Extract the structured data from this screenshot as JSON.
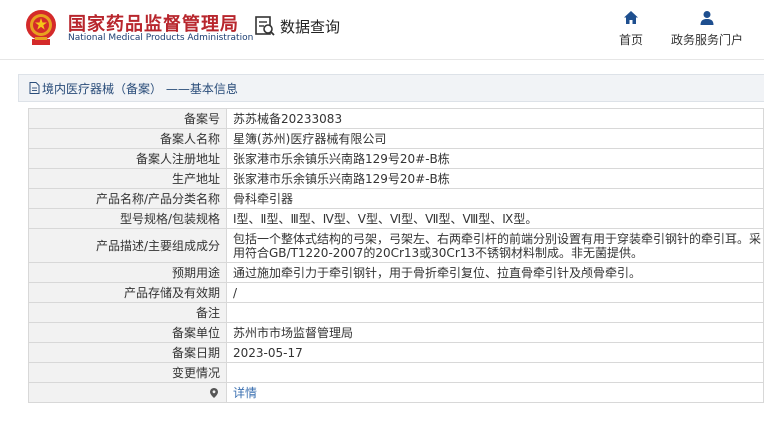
{
  "header": {
    "agency_cn": "国家药品监督管理局",
    "agency_en": "National Medical Products Administration",
    "query_label": "数据查询",
    "nav_home": "首页",
    "nav_portal": "政务服务门户"
  },
  "breadcrumb": {
    "text": "境内医疗器械（备案） ——基本信息"
  },
  "rows": [
    {
      "label": "备案号",
      "value": "苏苏械备20233083"
    },
    {
      "label": "备案人名称",
      "value": "星簿(苏州)医疗器械有限公司"
    },
    {
      "label": "备案人注册地址",
      "value": "张家港市乐余镇乐兴南路129号20#-B栋"
    },
    {
      "label": "生产地址",
      "value": "张家港市乐余镇乐兴南路129号20#-B栋"
    },
    {
      "label": "产品名称/产品分类名称",
      "value": "骨科牵引器"
    },
    {
      "label": "型号规格/包装规格",
      "value": "Ⅰ型、Ⅱ型、Ⅲ型、Ⅳ型、Ⅴ型、Ⅵ型、Ⅶ型、Ⅷ型、Ⅸ型。"
    },
    {
      "label": "产品描述/主要组成成分",
      "value": "包括一个整体式结构的弓架，弓架左、右两牵引杆的前端分别设置有用于穿装牵引钢针的牵引耳。采用符合GB/T1220-2007的20Cr13或30Cr13不锈钢材料制成。非无菌提供。"
    },
    {
      "label": "预期用途",
      "value": "通过施加牵引力于牵引钢针，用于骨折牵引复位、拉直骨牵引针及颅骨牵引。"
    },
    {
      "label": "产品存储及有效期",
      "value": "/"
    },
    {
      "label": "备注",
      "value": ""
    },
    {
      "label": "备案单位",
      "value": "苏州市市场监督管理局"
    },
    {
      "label": "备案日期",
      "value": "2023-05-17"
    },
    {
      "label": "变更情况",
      "value": ""
    },
    {
      "label": "",
      "value": "详情"
    }
  ],
  "colors": {
    "agency_red": "#b8262d",
    "agency_blue": "#1d3f73",
    "link_blue": "#3a6fb0",
    "label_bg": "#f2f2f2"
  },
  "icons": {
    "emblem": "national-emblem-icon",
    "query": "data-query-icon",
    "home": "home-icon",
    "portal": "user-icon",
    "breadcrumb": "document-icon",
    "detail": "location-pin-icon"
  }
}
